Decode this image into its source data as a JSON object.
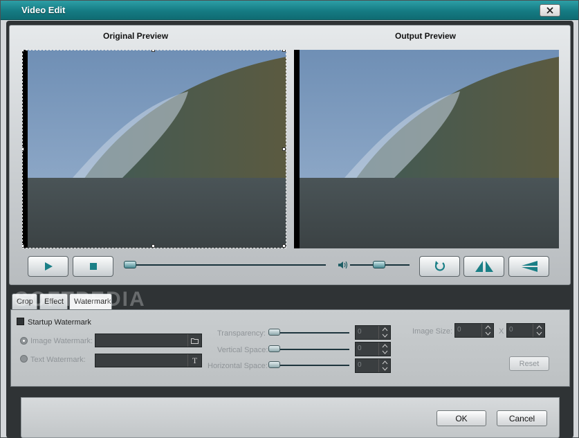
{
  "window": {
    "title": "Video Edit"
  },
  "preview": {
    "original_title": "Original Preview",
    "output_title": "Output Preview"
  },
  "controls": {
    "seek_position": 0.0,
    "volume_level": 0.5
  },
  "tabs": [
    {
      "label": "Crop"
    },
    {
      "label": "Effect"
    },
    {
      "label": "Watermark"
    }
  ],
  "watermark_overlay": "SOFTPEDIA",
  "watermark": {
    "startup_label": "Startup Watermark",
    "image_label": "Image Watermark:",
    "text_label": "Text Watermark:",
    "transparency_label": "Transparency:",
    "vertical_label": "Vertical Space:",
    "horizontal_label": "Horizontal Space:",
    "transparency_value": "0",
    "vertical_value": "0",
    "horizontal_value": "0",
    "image_size_label": "Image Size:",
    "image_size_w": "0",
    "image_size_h": "0",
    "size_sep": "X",
    "reset_label": "Reset"
  },
  "dialog": {
    "ok_label": "OK",
    "cancel_label": "Cancel"
  }
}
